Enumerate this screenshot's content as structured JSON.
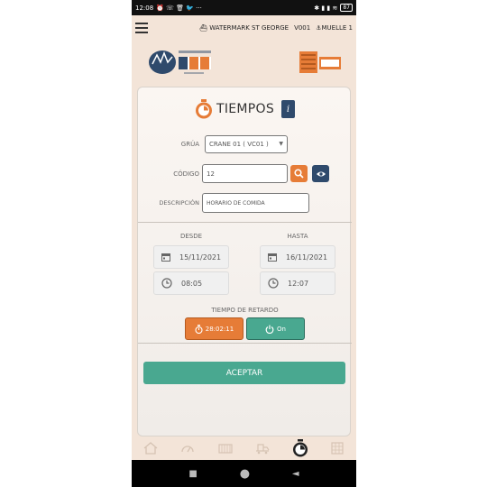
{
  "status": {
    "time": "12:08",
    "notif_icons": "⏰ ☏ 🗑 🐦 ···",
    "sys_icons": "✱ ▮ ▮ ≋",
    "battery": "87"
  },
  "topbar": {
    "vessel": "WATERMARK ST GEORGE",
    "voyage": "V001",
    "dock": "MUELLE 1"
  },
  "title": "TIEMPOS",
  "info_label": "i",
  "form": {
    "grua_label": "GRÚA",
    "grua_value": "CRANE 01 ( VC01 )",
    "codigo_label": "CÓDIGO",
    "codigo_value": "12",
    "descripcion_label": "DESCRIPCIÓN",
    "descripcion_value": "HORARIO DE COMIDA"
  },
  "range": {
    "desde_label": "DESDE",
    "hasta_label": "HASTA",
    "desde_date": "15/11/2021",
    "desde_time": "08:05",
    "hasta_date": "16/11/2021",
    "hasta_time": "12:07"
  },
  "retardo": {
    "label": "TIEMPO DE RETARDO",
    "timer": "28:02:11",
    "toggle": "On"
  },
  "accept_label": "ACEPTAR",
  "colors": {
    "accent_orange": "#e67c37",
    "accent_teal": "#49a890",
    "navy": "#2f4a6c"
  },
  "tabs": [
    "home-icon",
    "gauge-icon",
    "container-icon",
    "truck-icon",
    "stopwatch-icon",
    "building-icon"
  ],
  "nav": [
    "■",
    "●",
    "◄"
  ]
}
